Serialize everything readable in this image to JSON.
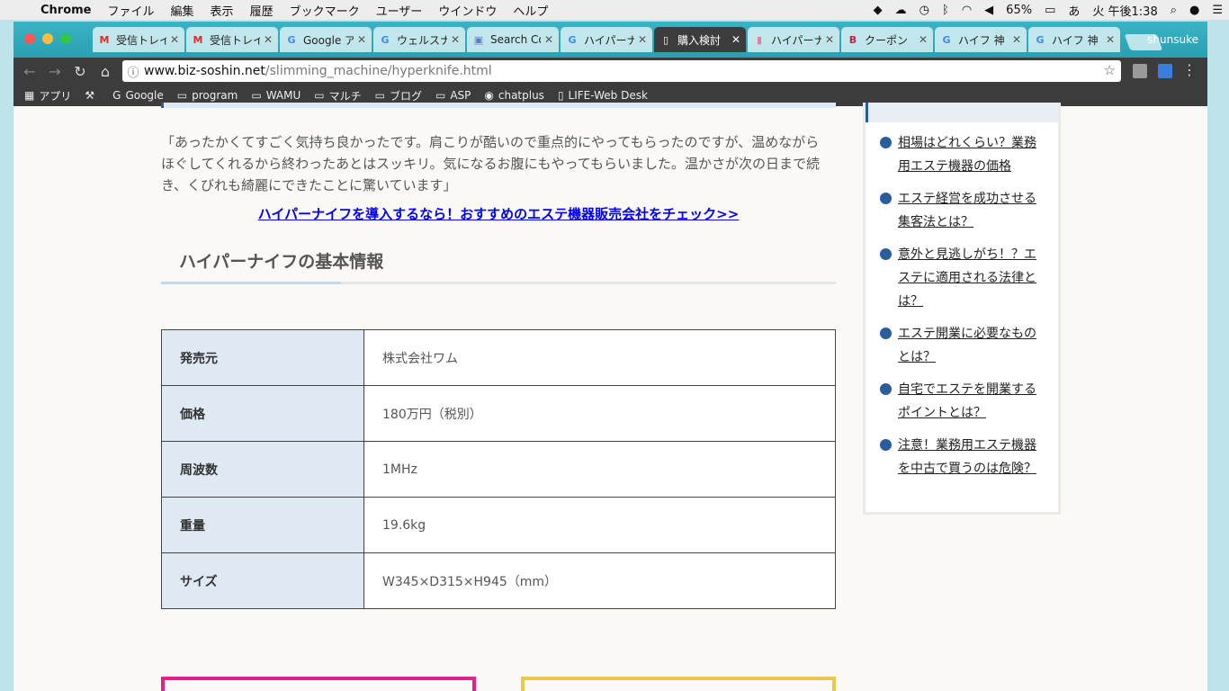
{
  "menubar": {
    "items": [
      "Chrome",
      "ファイル",
      "編集",
      "表示",
      "履歴",
      "ブックマーク",
      "ユーザー",
      "ウインドウ",
      "ヘルプ"
    ],
    "battery": "65%",
    "input_mode": "あ",
    "clock": "火 午後1:38"
  },
  "browser": {
    "tabs": [
      {
        "label": "受信トレイ",
        "icon": "M",
        "color": "#d93025"
      },
      {
        "label": "受信トレイ",
        "icon": "M",
        "color": "#d93025"
      },
      {
        "label": "Google アナリティクス",
        "icon": "G",
        "color": "#4285f4"
      },
      {
        "label": "ウェルスナビ",
        "icon": "G",
        "color": "#4285f4"
      },
      {
        "label": "Search Console",
        "icon": "▣",
        "color": "#5b7fc7"
      },
      {
        "label": "ハイパーナイフ",
        "icon": "G",
        "color": "#4285f4"
      },
      {
        "label": "購入検討",
        "icon": "▯",
        "color": "#ffffff",
        "active": true
      },
      {
        "label": "ハイパーナイフ",
        "icon": "▮",
        "color": "#e27ea0"
      },
      {
        "label": "クーポン",
        "icon": "B",
        "color": "#c0244a"
      },
      {
        "label": "ハイフ 神",
        "icon": "G",
        "color": "#4285f4"
      },
      {
        "label": "ハイフ 神",
        "icon": "G",
        "color": "#4285f4"
      }
    ],
    "user": "shunsuke",
    "url_host": "www.biz-soshin.net",
    "url_path": "/slimming_machine/hyperknife.html",
    "bookmarks": [
      {
        "label": "アプリ",
        "icon": "grid-icon"
      },
      {
        "label": "",
        "icon": "tool-icon"
      },
      {
        "label": "Google",
        "icon": "google-icon"
      },
      {
        "label": "program",
        "icon": "folder-icon"
      },
      {
        "label": "WAMU",
        "icon": "folder-icon"
      },
      {
        "label": "マルチ",
        "icon": "folder-icon"
      },
      {
        "label": "ブログ",
        "icon": "folder-icon"
      },
      {
        "label": "ASP",
        "icon": "folder-icon"
      },
      {
        "label": "chatplus",
        "icon": "chat-icon"
      },
      {
        "label": "LIFE-Web Desk",
        "icon": "page-icon"
      }
    ]
  },
  "article": {
    "quote": "「あったかくてすごく気持ち良かったです。肩こりが酷いので重点的にやってもらったのですが、温めながらほぐしてくれるから終わったあとはスッキリ。気になるお腹にもやってもらいました。温かさが次の日まで続き、くびれも綺麗にできたことに驚いています」",
    "cta_link": "ハイパーナイフを導入するなら！おすすめのエステ機器販売会社をチェック>>",
    "heading": "ハイパーナイフの基本情報",
    "spec_rows": [
      {
        "key": "発売元",
        "value": "株式会社ワム"
      },
      {
        "key": "価格",
        "value": "180万円（税別）"
      },
      {
        "key": "周波数",
        "value": "1MHz"
      },
      {
        "key": "重量",
        "value": "19.6kg"
      },
      {
        "key": "サイズ",
        "value": "W345×D315×H945（mm）"
      }
    ]
  },
  "sidebar": {
    "links": [
      "相場はどれくらい？業務用エステ機器の価格",
      "エステ経営を成功させる集客法とは？",
      "意外と見逃しがち！？エステに適用される法律とは？",
      "エステ開業に必要なものとは？",
      "自宅でエステを開業するポイントとは？",
      "注意！業務用エステ機器を中古で買うのは危険？"
    ]
  },
  "colors": {
    "accent": "#2a5d9b",
    "link": "#0000ee",
    "table_key_bg": "#dfe9f3",
    "banner_pink": "#e0238c",
    "banner_yellow": "#ecc84a"
  }
}
